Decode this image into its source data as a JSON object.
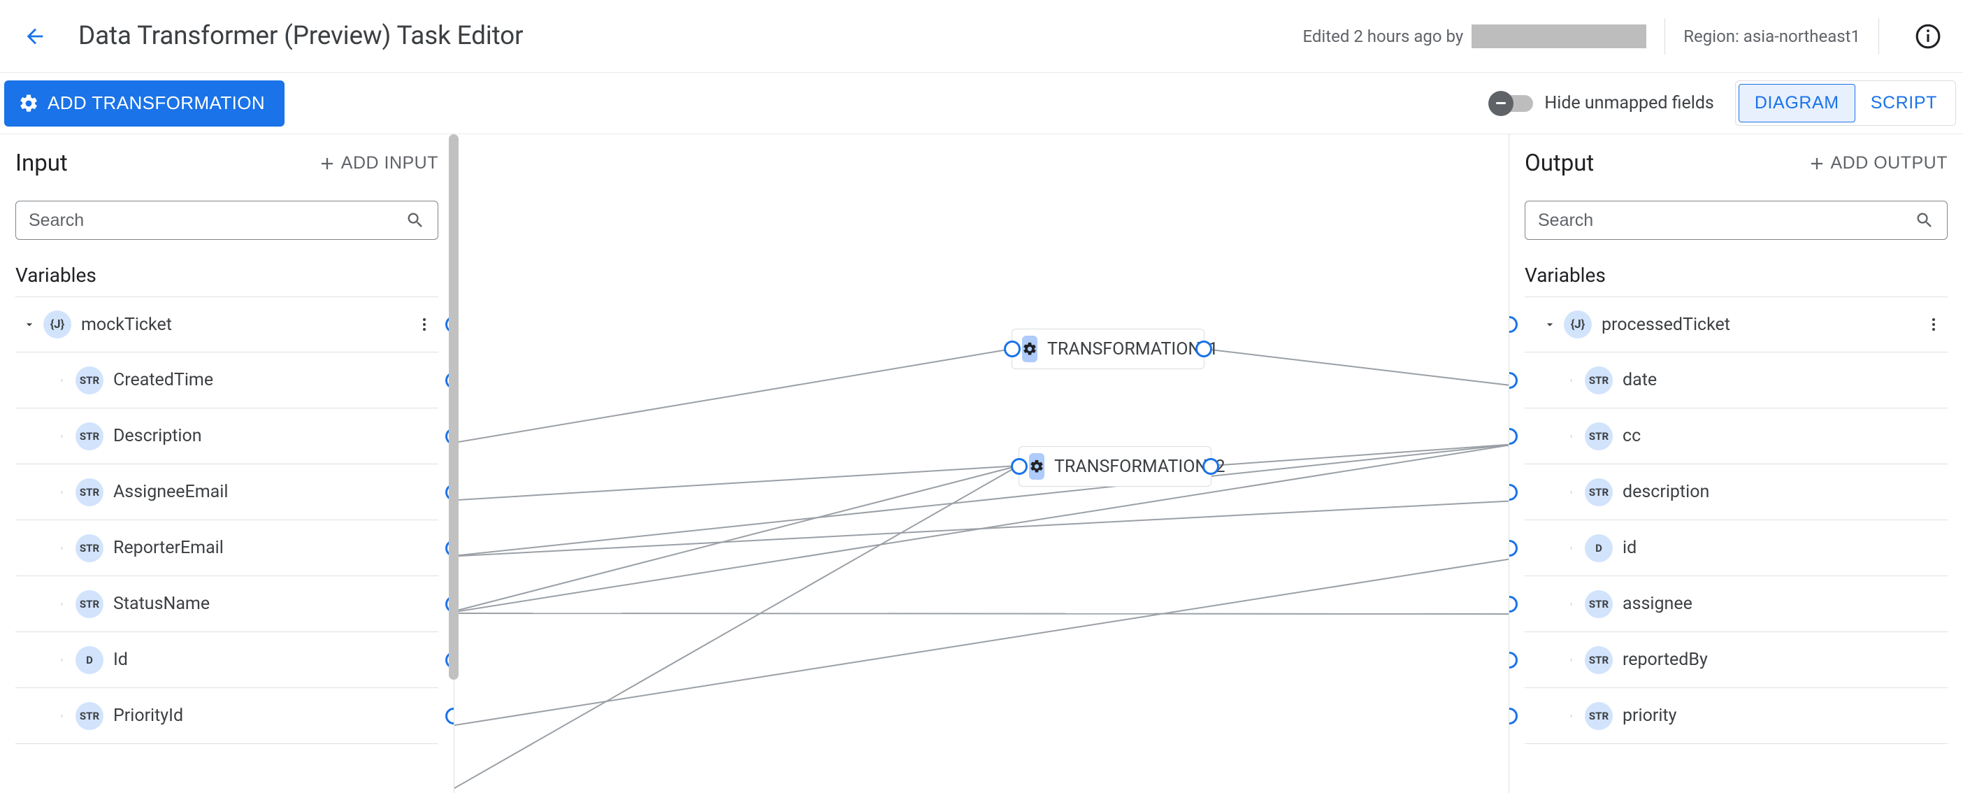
{
  "header": {
    "title": "Data Transformer (Preview) Task Editor",
    "edited_text": "Edited 2 hours ago by",
    "region_label": "Region: asia-northeast1"
  },
  "toolbar": {
    "add_transformation": "ADD TRANSFORMATION",
    "hide_unmapped_label": "Hide unmapped fields",
    "tabs": {
      "diagram": "DIAGRAM",
      "script": "SCRIPT"
    }
  },
  "input_panel": {
    "title": "Input",
    "add_btn": "ADD INPUT",
    "search_placeholder": "Search",
    "variables_label": "Variables",
    "root": {
      "name": "mockTicket",
      "type": "{J}"
    },
    "fields": [
      {
        "name": "CreatedTime",
        "type": "STR"
      },
      {
        "name": "Description",
        "type": "STR"
      },
      {
        "name": "AssigneeEmail",
        "type": "STR"
      },
      {
        "name": "ReporterEmail",
        "type": "STR"
      },
      {
        "name": "StatusName",
        "type": "STR"
      },
      {
        "name": "Id",
        "type": "D"
      },
      {
        "name": "PriorityId",
        "type": "STR"
      }
    ]
  },
  "output_panel": {
    "title": "Output",
    "add_btn": "ADD OUTPUT",
    "search_placeholder": "Search",
    "variables_label": "Variables",
    "root": {
      "name": "processedTicket",
      "type": "{J}"
    },
    "fields": [
      {
        "name": "date",
        "type": "STR"
      },
      {
        "name": "cc",
        "type": "STR"
      },
      {
        "name": "description",
        "type": "STR"
      },
      {
        "name": "id",
        "type": "D"
      },
      {
        "name": "assignee",
        "type": "STR"
      },
      {
        "name": "reportedBy",
        "type": "STR"
      },
      {
        "name": "priority",
        "type": "STR"
      }
    ]
  },
  "nodes": {
    "t1": "TRANSFORMATION_1",
    "t2": "TRANSFORMATION_2"
  }
}
